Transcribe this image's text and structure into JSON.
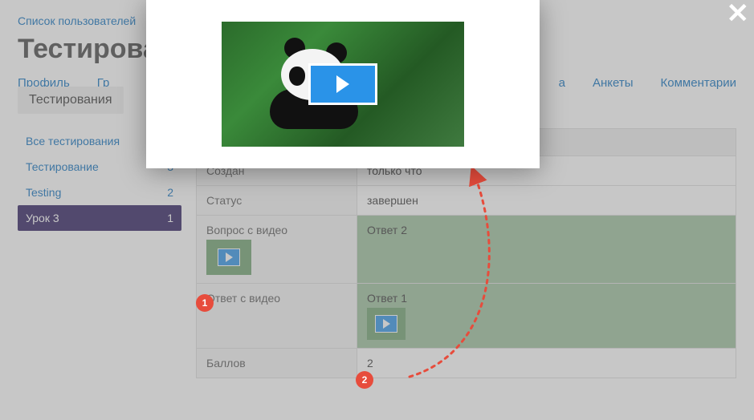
{
  "breadcrumb": "Список пользователей",
  "page_title": "Тестирова",
  "tabs": {
    "profile": "Профиль",
    "groups": "Гр",
    "active": "Тестирования",
    "far1": "а",
    "surveys": "Анкеты",
    "comments": "Комментарии"
  },
  "sidebar": {
    "items": [
      {
        "label": "Все тестирования",
        "count": ""
      },
      {
        "label": "Тестирование",
        "count": "3"
      },
      {
        "label": "Testing",
        "count": "2"
      },
      {
        "label": "Урок 3",
        "count": "1"
      }
    ]
  },
  "rows": {
    "created_label": "Создан",
    "created_value": "только что",
    "status_label": "Статус",
    "status_value": "завершен",
    "qvideo_label": "Вопрос с видео",
    "answer2": "Ответ 2",
    "avideo_label": "Ответ с видео",
    "answer1": "Ответ 1",
    "points_label": "Баллов",
    "points_value": "2"
  },
  "close": "✕",
  "markers": {
    "m1": "1",
    "m2": "2"
  }
}
